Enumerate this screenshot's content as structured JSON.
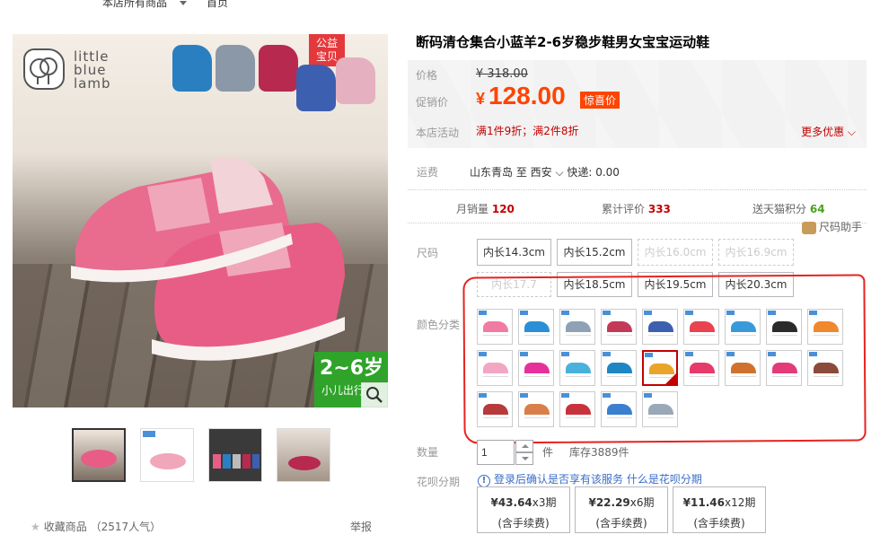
{
  "topnav": {
    "all_products": "本店所有商品",
    "home": "首页"
  },
  "gallery": {
    "brand_logo_text": [
      "little",
      "blue",
      "lamb"
    ],
    "badge": [
      "公益",
      "宝贝"
    ],
    "age_range": "2~6岁",
    "age_sub": "小儿出行"
  },
  "sidebar_actions": {
    "favorite": "收藏商品",
    "favorite_count": "（2517人气）",
    "report": "举报"
  },
  "product": {
    "title": "断码清仓集合小蓝羊2-6岁稳步鞋男女宝宝运动鞋",
    "price_label": "价格",
    "original_price": "¥ 318.00",
    "promo_label": "促销价",
    "promo_currency": "¥",
    "promo_price": "128.00",
    "promo_tag": "惊喜价",
    "activity_label": "本店活动",
    "activity_text": "满1件9折；满2件8折",
    "more_offers": "更多优惠"
  },
  "shipping": {
    "label": "运费",
    "value": "山东青岛  至  西安 ⌵  快递: 0.00"
  },
  "stats": {
    "monthly_sales_label": "月销量",
    "monthly_sales": "120",
    "reviews_label": "累计评价",
    "reviews": "333",
    "points_label": "送天猫积分",
    "points": "64"
  },
  "size_helper": "尺码助手",
  "sizes": {
    "label": "尺码",
    "options": [
      {
        "text": "内长14.3cm",
        "disabled": false
      },
      {
        "text": "内长15.2cm",
        "disabled": false
      },
      {
        "text": "内长16.0cm",
        "disabled": true
      },
      {
        "text": "内长16.9cm",
        "disabled": true
      },
      {
        "text": "内长17.7",
        "disabled": true
      },
      {
        "text": "内长18.5cm",
        "disabled": false
      },
      {
        "text": "内长19.5cm",
        "disabled": false
      },
      {
        "text": "内长20.3cm",
        "disabled": false
      }
    ]
  },
  "colors": {
    "label": "颜色分类",
    "swatches": [
      "#f27ba3",
      "#2a8fd6",
      "#8fa2b5",
      "#c23a58",
      "#3d5fb0",
      "#e8434f",
      "#3a9ad9",
      "#2b2b2b",
      "#f0882e",
      "#f2a6c4",
      "#e8309a",
      "#4ab0dc",
      "#1f86c4",
      "#e8a52a",
      "#e53a6a",
      "#d0722e",
      "#e33b7a",
      "#8b4a3a",
      "#b83a3a",
      "#d97f4a",
      "#c8323c",
      "#3a7fd0",
      "#9aa8b8"
    ],
    "selected_index": 13
  },
  "quantity": {
    "label": "数量",
    "value": "1",
    "unit": "件",
    "stock": "库存3889件"
  },
  "huabei": {
    "label": "花呗分期",
    "note": "登录后确认是否享有该服务",
    "link": "什么是花呗分期",
    "plans": [
      {
        "amount": "¥43.64",
        "periods": "x3期",
        "fee": "(含手续费)"
      },
      {
        "amount": "¥22.29",
        "periods": "x6期",
        "fee": "(含手续费)"
      },
      {
        "amount": "¥11.46",
        "periods": "x12期",
        "fee": "(含手续费)"
      }
    ]
  }
}
